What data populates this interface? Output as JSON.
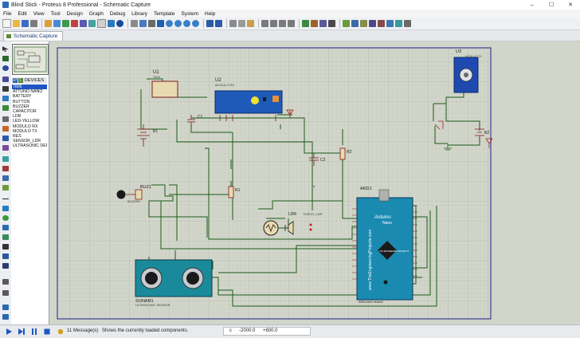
{
  "window": {
    "title": "Blind Stick - Proteus 8 Professional - Schematic Capture",
    "minimize": "–",
    "maximize": "☐",
    "close": "✕"
  },
  "menu": [
    "File",
    "Edit",
    "View",
    "Tool",
    "Design",
    "Graph",
    "Debug",
    "Library",
    "Template",
    "System",
    "Help"
  ],
  "tab": {
    "label": "Schematic Capture"
  },
  "devices": {
    "p_label": "P",
    "l_label": "L",
    "title": "DEVICES",
    "items": [
      "7805",
      "ATTUNO NANO",
      "BATTERY",
      "BUTTON",
      "BUZZER",
      "CAPACITOR",
      "LDR",
      "LED-YELLOW",
      "MODULO RX",
      "MODULO TX",
      "RES",
      "SENSOR_LDR",
      "ULTRASONIC DEP"
    ],
    "selected_index": 0
  },
  "schematic": {
    "u1": {
      "ref": "U1",
      "part": "7805"
    },
    "u2": {
      "ref": "U2",
      "part": "MODULO RX"
    },
    "u3": {
      "ref": "U3",
      "part": "MODULO TX"
    },
    "c1": "C1",
    "c2": "C2",
    "b1": "B1",
    "b2": "B2",
    "r1": "R1",
    "r2": "R2",
    "buzzer": {
      "ref": "BUZ1",
      "part": "BUZZER"
    },
    "ldr": {
      "ref": "LDR1",
      "part": "TORCH_LDR"
    },
    "lamp_label": "LDR",
    "arduino": {
      "ref": "ARD1",
      "name": "Arduino",
      "sub": "Nano",
      "vertical": "www.TheEngineeringProjects.com",
      "logo": "THE ENGINEERING PROJECTS",
      "part": "ARDUINO NANO"
    },
    "sonar": {
      "ref": "SONAR1",
      "part": "ULTRASONIC SENSOR"
    }
  },
  "status": {
    "messages": "11 Message(s)",
    "hint": "Shows the currently loaded components.",
    "coord_x_label": "c",
    "coord_x": "-2000.0",
    "coord_y": "+800.0"
  }
}
